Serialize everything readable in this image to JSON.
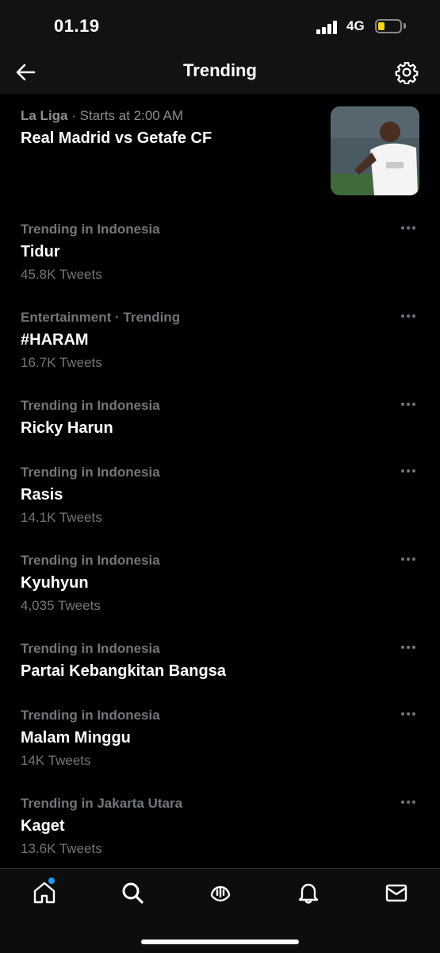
{
  "status_bar": {
    "time": "01.19",
    "network": "4G",
    "battery_color": "#ffd60a"
  },
  "header": {
    "title": "Trending",
    "back_icon": "arrow-left-icon",
    "settings_icon": "gear-icon"
  },
  "featured": {
    "category": "La Liga",
    "separator": " · ",
    "time_info": "Starts at 2:00 AM",
    "title": "Real Madrid vs Getafe CF",
    "thumbnail_icon": "football-player-photo"
  },
  "trends": [
    {
      "context": "Trending in Indonesia",
      "name": "Tidur",
      "count": "45.8K Tweets"
    },
    {
      "context": "Entertainment · Trending",
      "name": "#HARAM",
      "count": "16.7K Tweets"
    },
    {
      "context": "Trending in Indonesia",
      "name": "Ricky Harun",
      "count": ""
    },
    {
      "context": "Trending in Indonesia",
      "name": "Rasis",
      "count": "14.1K Tweets"
    },
    {
      "context": "Trending in Indonesia",
      "name": "Kyuhyun",
      "count": "4,035 Tweets"
    },
    {
      "context": "Trending in Indonesia",
      "name": "Partai Kebangkitan Bangsa",
      "count": ""
    },
    {
      "context": "Trending in Indonesia",
      "name": "Malam Minggu",
      "count": "14K Tweets"
    },
    {
      "context": "Trending in Jakarta Utara",
      "name": "Kaget",
      "count": "13.6K Tweets"
    }
  ],
  "tabbar": {
    "items": [
      "home-icon",
      "search-icon",
      "spaces-icon",
      "bell-icon",
      "mail-icon"
    ],
    "accent": "#1d9bf0"
  }
}
